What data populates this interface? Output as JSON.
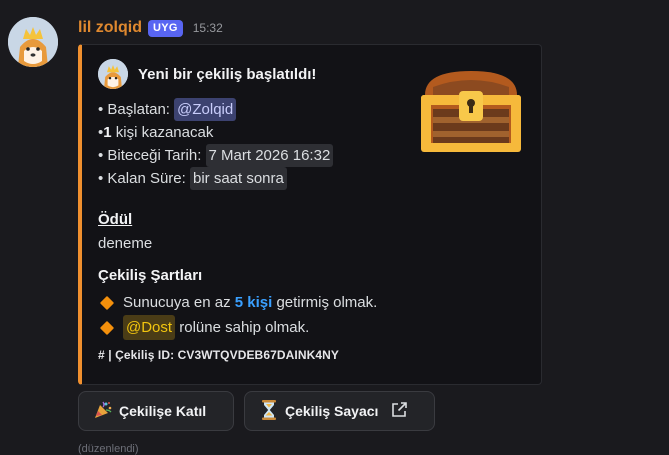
{
  "message": {
    "username": "lil zolqid",
    "app_badge": "UYG",
    "timestamp": "15:32",
    "edited_label": "(düzenlendi)"
  },
  "embed": {
    "accent_color": "#f0902f",
    "author": "Yeni bir çekiliş başlatıldı!",
    "thumbnail_icon": "treasure-chest-icon",
    "lines": {
      "host_label": "• Başlatan:",
      "host_mention": "@Zolqid",
      "winners_prefix": "• ",
      "winners_count": "1",
      "winners_text": " kişi kazanacak",
      "end_label": "• Biteceği Tarih:",
      "end_value": "7 Mart 2026 16:32",
      "remaining_label": "• Kalan Süre:",
      "remaining_value": "bir saat sonra"
    },
    "prize_title": "Ödül",
    "prize_value": "deneme",
    "requirements_title": "Çekiliş Şartları",
    "requirements": [
      {
        "before": "Sunucuya en az ",
        "highlight": "5 kişi",
        "after": " getirmiş olmak."
      },
      {
        "mention": "@Dost",
        "after": " rolüne sahip olmak."
      }
    ],
    "footer": "# | Çekiliş ID: CV3WTQVDEB67DAINK4NY"
  },
  "buttons": {
    "join": {
      "icon": "party-popper-icon",
      "label": "Çekilişe Katıl"
    },
    "timer": {
      "icon": "hourglass-icon",
      "label": "Çekiliş Sayacı",
      "trail_icon": "external-link-icon"
    }
  },
  "colors": {
    "username": "#e0892f",
    "badge": "#5865f2",
    "mention_bg": "#3c4270",
    "role_mention": "#f1c40f",
    "highlight": "#3aa0ff",
    "bullet_diamond": "#f4900c"
  }
}
